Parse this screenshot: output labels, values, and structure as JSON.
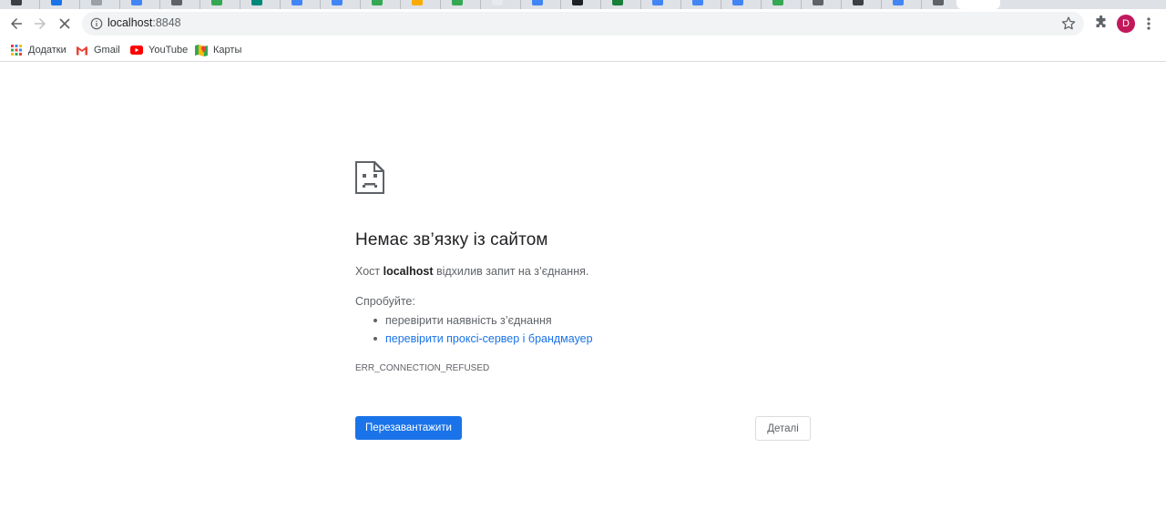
{
  "browser": {
    "url_host": "localhost",
    "url_port": ":8848",
    "profile_initial": "D",
    "accent_color": "#1a73e8",
    "tab_favicon_colors": [
      "#3c4043",
      "#1a73e8",
      "#9aa0a6",
      "#4285f4",
      "#5f6368",
      "#34a853",
      "#00897b",
      "#4285f4",
      "#4285f4",
      "#34a853",
      "#f9ab00",
      "#34a853",
      "#e8eaed",
      "#4285f4",
      "#202124",
      "#188038",
      "#4285f4",
      "#4285f4",
      "#4285f4",
      "#34a853",
      "#5f6368",
      "#3c4043",
      "#4285f4",
      "#5f6368"
    ]
  },
  "bookmarks": [
    {
      "label": "Додатки",
      "icon": "apps-grid-icon"
    },
    {
      "label": "Gmail",
      "icon": "gmail-icon"
    },
    {
      "label": "YouTube",
      "icon": "youtube-icon"
    },
    {
      "label": "Карты",
      "icon": "maps-icon"
    }
  ],
  "error": {
    "icon": "sad-page-icon",
    "title": "Немає зв’язку із сайтом",
    "desc_prefix": "Хост ",
    "desc_host": "localhost",
    "desc_suffix": " відхилив запит на з’єднання.",
    "try_label": "Спробуйте:",
    "suggestions": [
      {
        "text": "перевірити наявність з’єднання",
        "link": false
      },
      {
        "text": "перевірити проксі-сервер і брандмауер",
        "link": true
      }
    ],
    "code": "ERR_CONNECTION_REFUSED",
    "reload_label": "Перезавантажити",
    "details_label": "Деталі"
  }
}
